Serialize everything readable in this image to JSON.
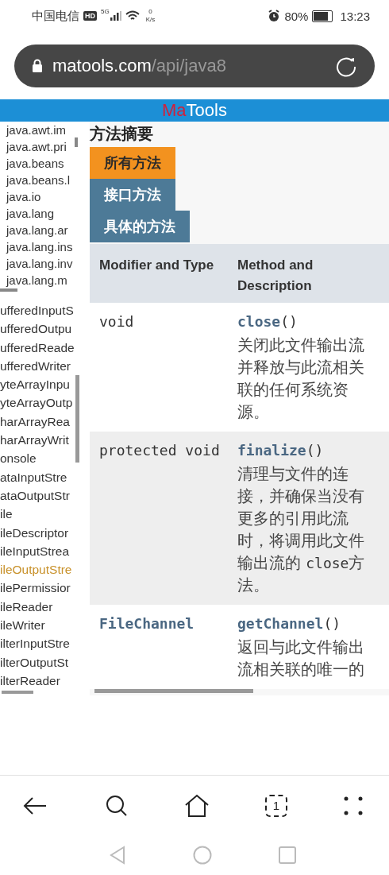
{
  "status_bar": {
    "carrier": "中国电信",
    "hd": "HD",
    "network": "5G",
    "speed_value": "0",
    "speed_unit": "K/s",
    "battery_text": "80%",
    "time": "13:23"
  },
  "address_bar": {
    "domain": "matools.com",
    "path": "/api/java8"
  },
  "site_header": {
    "logo_part_1": "Ma",
    "logo_part_2": "Tools"
  },
  "packages": [
    "java.awt.im",
    "java.awt.pri",
    "java.beans",
    "java.beans.l",
    "java.io",
    "java.lang",
    "java.lang.ar",
    "java.lang.ins",
    "java.lang.inv",
    "java.lang.m"
  ],
  "classes": [
    {
      "label": "ufferedInputS",
      "selected": false
    },
    {
      "label": "ufferedOutpu",
      "selected": false
    },
    {
      "label": "ufferedReade",
      "selected": false
    },
    {
      "label": "ufferedWriter",
      "selected": false
    },
    {
      "label": "yteArrayInpu",
      "selected": false
    },
    {
      "label": "yteArrayOutp",
      "selected": false
    },
    {
      "label": "harArrayRea",
      "selected": false
    },
    {
      "label": "harArrayWrit",
      "selected": false
    },
    {
      "label": "onsole",
      "selected": false
    },
    {
      "label": "ataInputStre",
      "selected": false
    },
    {
      "label": "ataOutputStr",
      "selected": false
    },
    {
      "label": "ile",
      "selected": false
    },
    {
      "label": "ileDescriptor",
      "selected": false
    },
    {
      "label": "ileInputStrea",
      "selected": false
    },
    {
      "label": "ileOutputStre",
      "selected": true
    },
    {
      "label": "ilePermissior",
      "selected": false
    },
    {
      "label": "ileReader",
      "selected": false
    },
    {
      "label": "ileWriter",
      "selected": false
    },
    {
      "label": "ilterInputStre",
      "selected": false
    },
    {
      "label": "ilterOutputSt",
      "selected": false
    },
    {
      "label": "ilterReader",
      "selected": false
    }
  ],
  "section_heading": "方法摘要",
  "tabs": [
    {
      "label": "所有方法",
      "selected": true
    },
    {
      "label": "接口方法",
      "selected": false
    },
    {
      "label": "具体的方法",
      "selected": false
    }
  ],
  "table": {
    "columns": [
      "Modifier and Type",
      "Method and Description"
    ],
    "rows": [
      {
        "type": {
          "text": "void",
          "link": false
        },
        "signature": "**close**()",
        "description": [
          {
            "text": "关闭此文件输出流并释放与此流相关联的任何系统资源。",
            "code": false
          }
        ]
      },
      {
        "type": {
          "text": "protected void",
          "link": false
        },
        "signature": "**finalize**()",
        "description": [
          {
            "text": "清理与文件的连接，并确保当没有更多的引用此流时，将调用此文件输出流的 ",
            "code": false
          },
          {
            "text": "close",
            "code": true
          },
          {
            "text": "方法。",
            "code": false
          }
        ]
      },
      {
        "type": {
          "text": "FileChannel",
          "link": true
        },
        "signature": "**getChannel**()",
        "description": [
          {
            "text": "返回与此文件输出流相关联的唯一的",
            "code": false
          }
        ]
      }
    ]
  },
  "bottom_nav": {
    "tab_count": "1"
  }
}
